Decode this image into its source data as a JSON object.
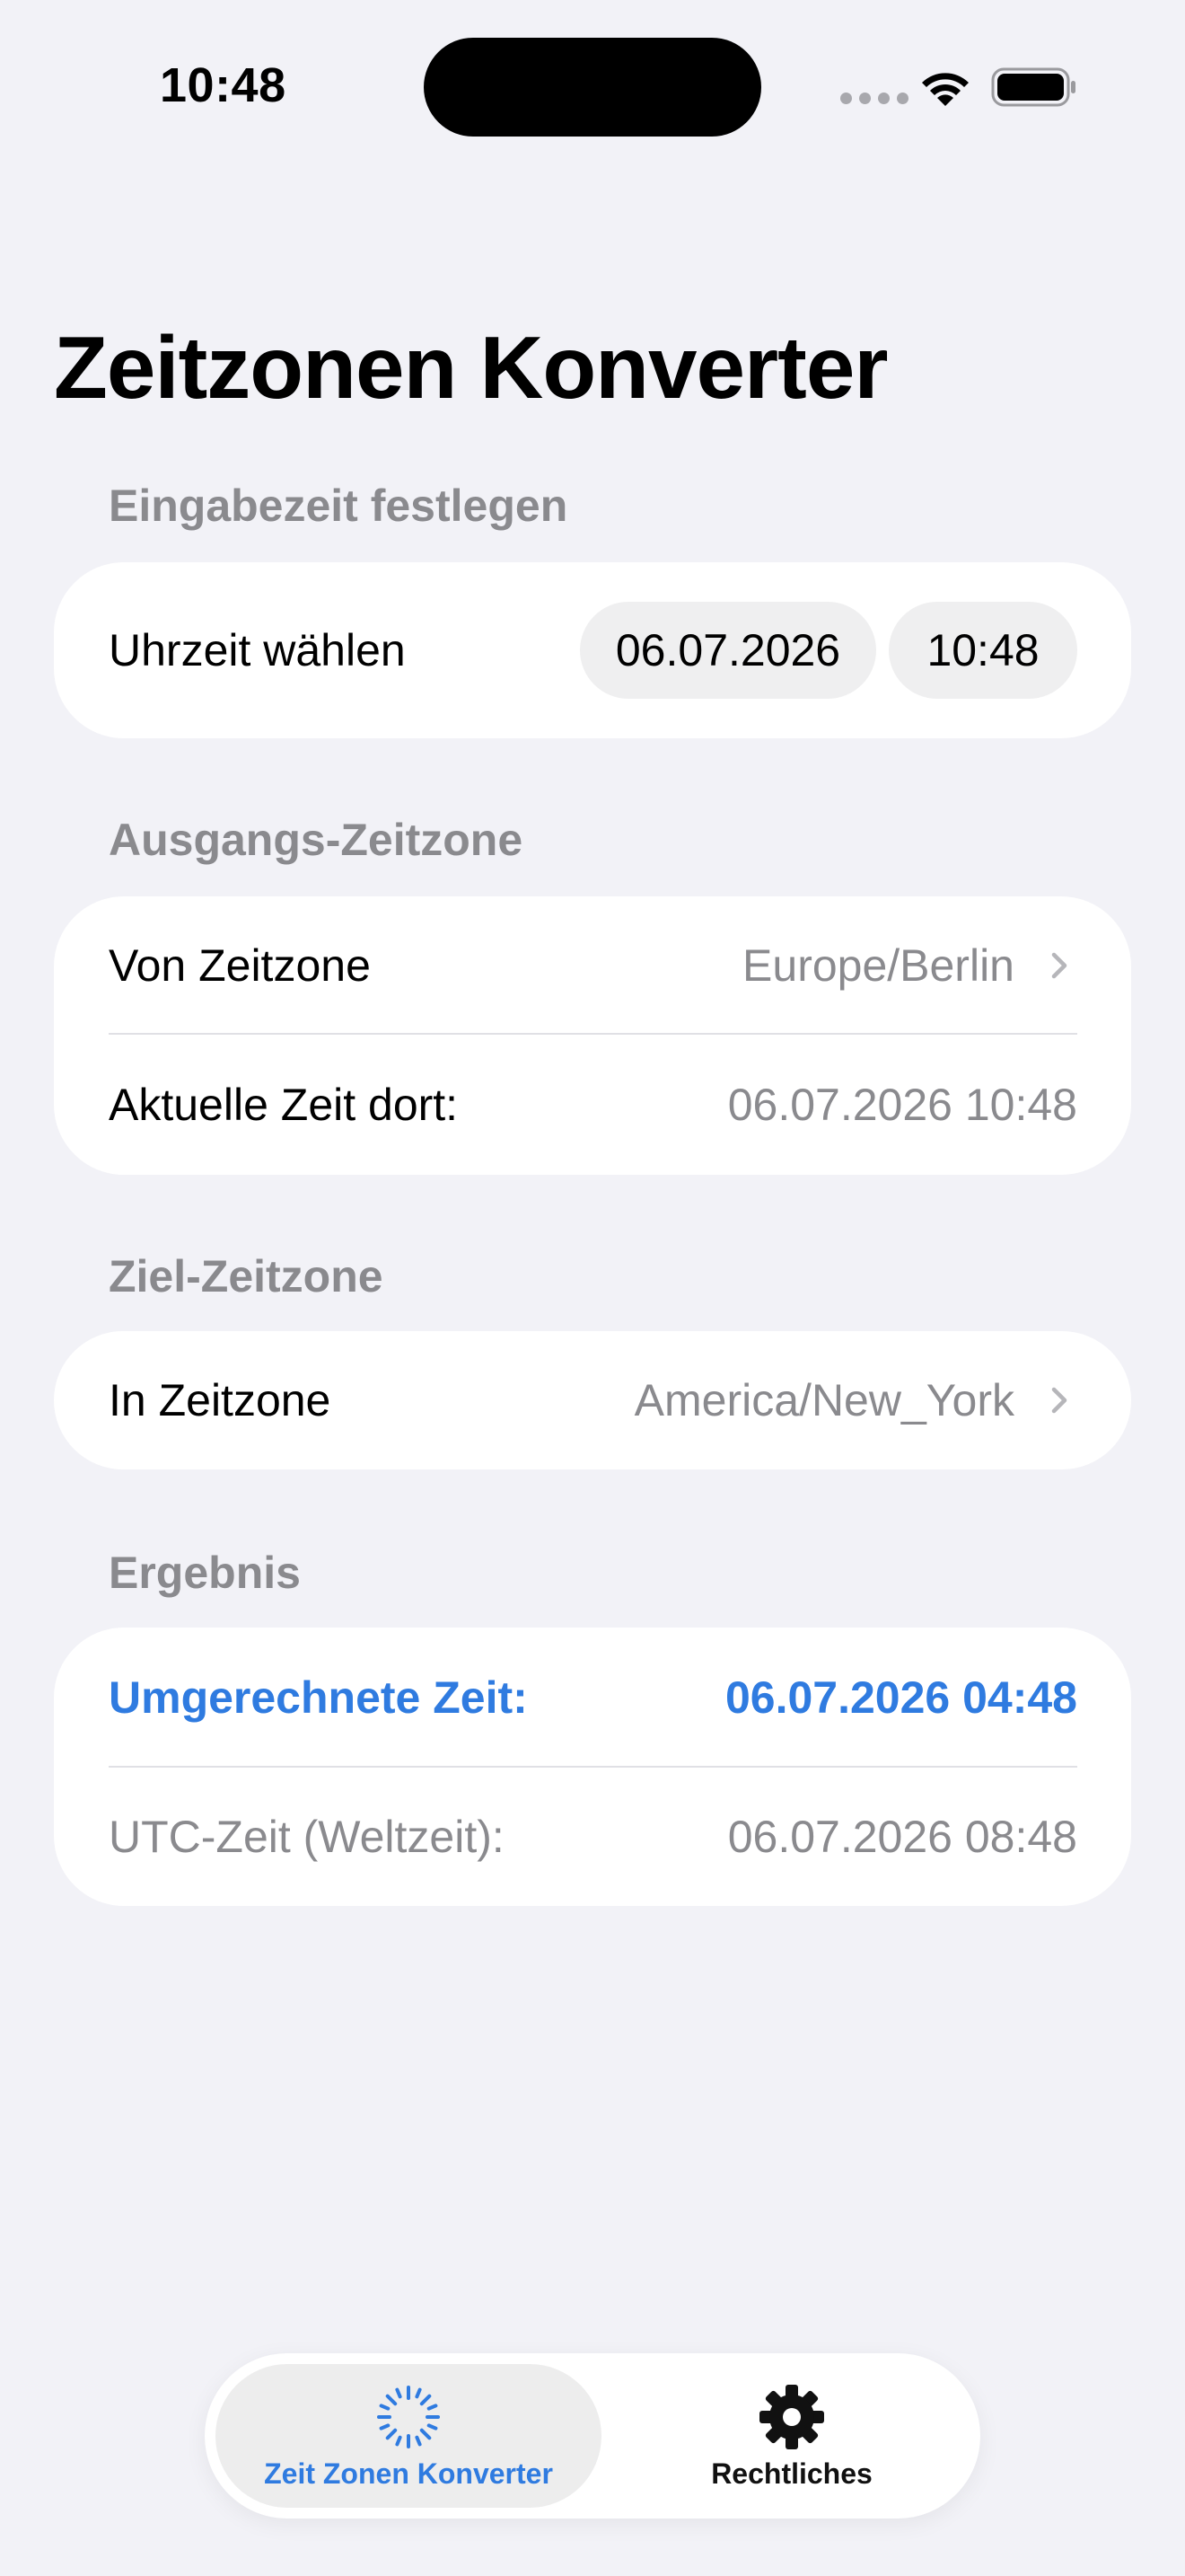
{
  "status_bar": {
    "time": "10:48"
  },
  "page": {
    "title": "Zeitzonen Konverter"
  },
  "sections": {
    "input": {
      "header": "Eingabezeit festlegen",
      "label": "Uhrzeit wählen",
      "date": "06.07.2026",
      "time": "10:48"
    },
    "source": {
      "header": "Ausgangs-Zeitzone",
      "zone_label": "Von Zeitzone",
      "zone_value": "Europe/Berlin",
      "current_label": "Aktuelle Zeit dort:",
      "current_value": "06.07.2026 10:48"
    },
    "target": {
      "header": "Ziel-Zeitzone",
      "zone_label": "In Zeitzone",
      "zone_value": "America/New_York"
    },
    "result": {
      "header": "Ergebnis",
      "converted_label": "Umgerechnete Zeit:",
      "converted_value": "06.07.2026 04:48",
      "utc_label": "UTC-Zeit (Weltzeit):",
      "utc_value": "06.07.2026 08:48"
    }
  },
  "tabs": [
    {
      "label": "Zeit Zonen Konverter",
      "icon": "dashed-circle-icon",
      "active": true
    },
    {
      "label": "Rechtliches",
      "icon": "gear-icon",
      "active": false
    }
  ],
  "colors": {
    "accent": "#2F7BE0",
    "background": "#F2F2F7",
    "secondary_text": "#8A8A8E"
  }
}
